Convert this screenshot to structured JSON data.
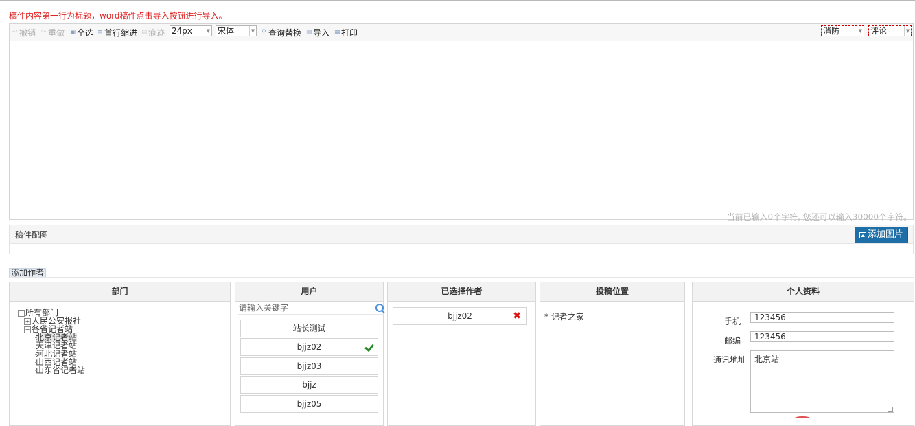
{
  "hint": "稿件内容第一行为标题，word稿件点击导入按钮进行导入。",
  "toolbar": {
    "undo": "撤销",
    "redo": "重做",
    "select_all": "全选",
    "first_indent": "首行缩进",
    "trace": "痕迹",
    "font_size": "24px",
    "font_family": "宋体",
    "find_replace": "查询替换",
    "import": "导入",
    "print": "打印",
    "category1": "消防",
    "category2": "评论"
  },
  "editor": {
    "counter": "当前已输入0个字符, 您还可以输入30000个字符。"
  },
  "picture": {
    "title": "稿件配图",
    "add_button": "添加图片"
  },
  "author_section": {
    "tab_label": "添加作者"
  },
  "columns": {
    "dept": "部门",
    "users": "用户",
    "selected": "已选择作者",
    "position": "投稿位置",
    "profile": "个人资料"
  },
  "dept_tree": {
    "root": "所有部门",
    "node1": "人民公安报社",
    "node2": "各省记者站",
    "leaves": [
      "北京记者站",
      "天津记者站",
      "河北记者站",
      "山西记者站",
      "山东省记者站"
    ]
  },
  "users": {
    "search_placeholder": "请输入关键字",
    "items": [
      "站长测试",
      "bjjz02",
      "bjjz03",
      "bjjz",
      "bjjz05"
    ]
  },
  "selected_authors": [
    "bjjz02"
  ],
  "position": {
    "item": "* 记者之家"
  },
  "profile": {
    "phone_label": "手机",
    "phone_value": "123456",
    "zip_label": "邮编",
    "zip_value": "123456",
    "address_label": "通讯地址",
    "address_value": "北京站"
  }
}
